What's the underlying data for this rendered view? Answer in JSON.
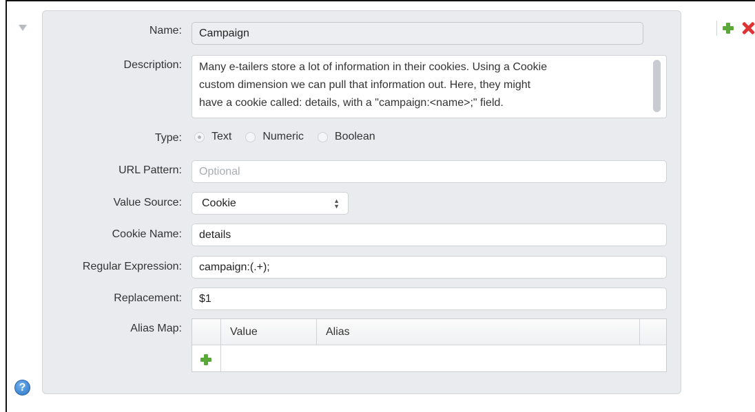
{
  "form": {
    "name_label": "Name:",
    "name_value": "Campaign",
    "description_label": "Description:",
    "description_lines": [
      "Many e-tailers store a lot of information in their cookies. Using a Cookie",
      "custom dimension we can pull that information out. Here, they might",
      "have a cookie called: details, with a \"campaign:<name>;\" field."
    ],
    "type_label": "Type:",
    "type_options": [
      "Text",
      "Numeric",
      "Boolean"
    ],
    "type_selected": "Text",
    "url_pattern_label": "URL Pattern:",
    "url_pattern_placeholder": "Optional",
    "value_source_label": "Value Source:",
    "value_source_selected": "Cookie",
    "cookie_name_label": "Cookie Name:",
    "cookie_name_value": "details",
    "regex_label": "Regular Expression:",
    "regex_value": "campaign:(.+);",
    "replacement_label": "Replacement:",
    "replacement_value": "$1",
    "alias_map_label": "Alias Map:",
    "alias_columns": [
      "Value",
      "Alias"
    ]
  },
  "help": {
    "label": "?"
  },
  "colors": {
    "add": "#5aa83a",
    "delete": "#dd3333",
    "help": "#2d74c2"
  }
}
